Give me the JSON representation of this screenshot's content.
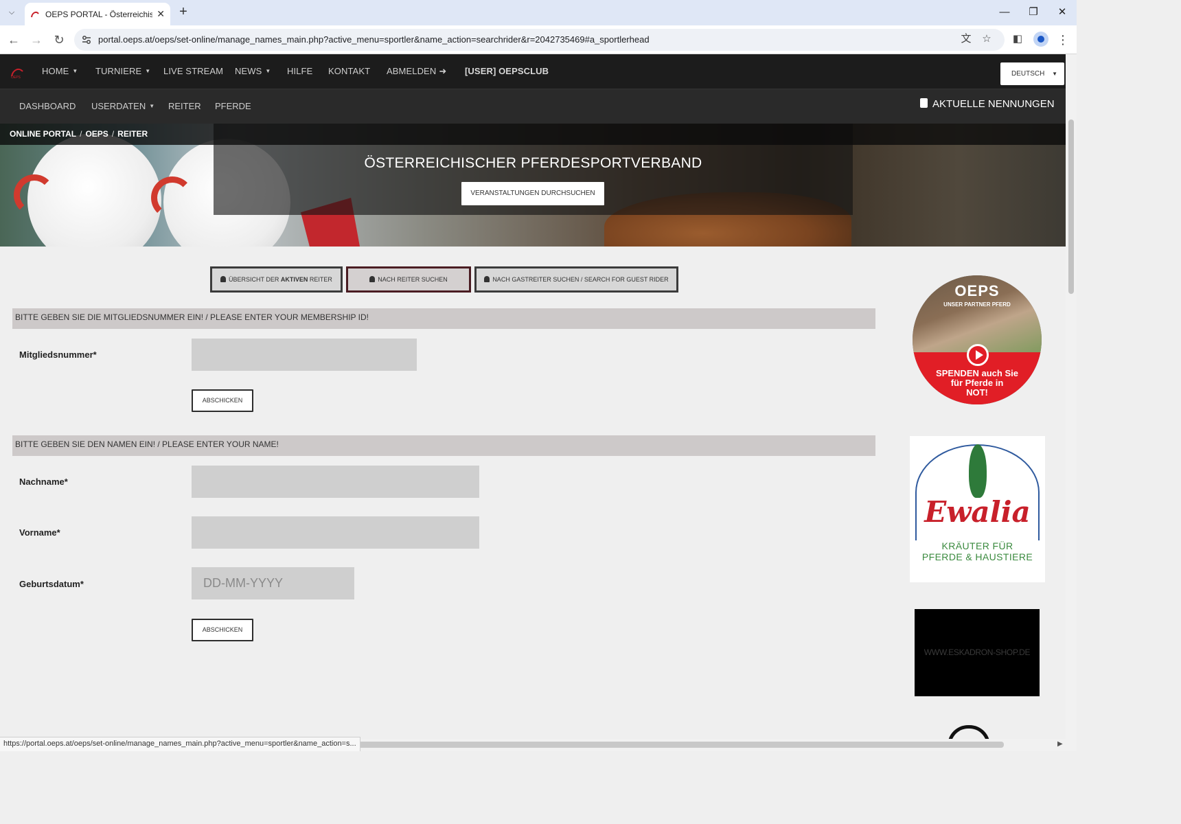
{
  "browser": {
    "tab_title": "OEPS PORTAL - Österreichische",
    "url": "portal.oeps.at/oeps/set-online/manage_names_main.php?active_menu=sportler&name_action=searchrider&r=2042735469#a_sportlerhead",
    "status_url": "https://portal.oeps.at/oeps/set-online/manage_names_main.php?active_menu=sportler&name_action=s..."
  },
  "topnav": {
    "items": [
      "HOME",
      "TURNIERE",
      "LIVE STREAM",
      "NEWS",
      "HILFE",
      "KONTAKT",
      "ABMELDEN",
      "[USER] OEPSCLUB"
    ],
    "language": "DEUTSCH"
  },
  "subnav": {
    "items": [
      "DASHBOARD",
      "USERDATEN",
      "REITER",
      "PFERDE"
    ],
    "aktuelle": "AKTUELLE NENNUNGEN"
  },
  "breadcrumb": [
    "ONLINE PORTAL",
    "OEPS",
    "REITER"
  ],
  "hero": {
    "title": "ÖSTERREICHISCHER PFERDESPORTVERBAND",
    "button": "VERANSTALTUNGEN DURCHSUCHEN"
  },
  "tabs": {
    "overview_pre": "ÜBERSICHT DER ",
    "overview_bold": "AKTIVEN",
    "overview_post": " REITER",
    "search": "NACH REITER SUCHEN",
    "guest": "NACH GASTREITER SUCHEN / SEARCH FOR GUEST RIDER"
  },
  "membership": {
    "heading": "BITTE GEBEN SIE DIE MITGLIEDSNUMMER EIN! / PLEASE ENTER YOUR MEMBERSHIP ID!",
    "label": "Mitgliedsnummer*",
    "value": "",
    "submit": "ABSCHICKEN"
  },
  "name_form": {
    "heading": "BITTE GEBEN SIE DEN NAMEN EIN! / PLEASE ENTER YOUR NAME!",
    "lastname_label": "Nachname*",
    "firstname_label": "Vorname*",
    "birthdate_label": "Geburtsdatum*",
    "birthdate_placeholder": "DD-MM-YYYY",
    "submit": "ABSCHICKEN"
  },
  "ads": {
    "oeps_brand": "OEPS",
    "oeps_sub": "UNSER PARTNER PFERD",
    "oeps_cta_1": "SPENDEN auch Sie",
    "oeps_cta_2": "für Pferde in",
    "oeps_cta_3": "NOT!",
    "ewalia_name": "Ewalia",
    "ewalia_line1": "KRÄUTER FÜR",
    "ewalia_line2": "PFERDE & HAUSTIERE",
    "eskadron": "WWW.ESKADRON-SHOP.DE"
  },
  "colors": {
    "nav_bg": "#1c1c1c",
    "subnav_bg": "#2a2a2a",
    "section_head_bg": "#cdc9c9",
    "input_bg": "#cfcfcf",
    "active_tab_border": "#4a1c22"
  }
}
